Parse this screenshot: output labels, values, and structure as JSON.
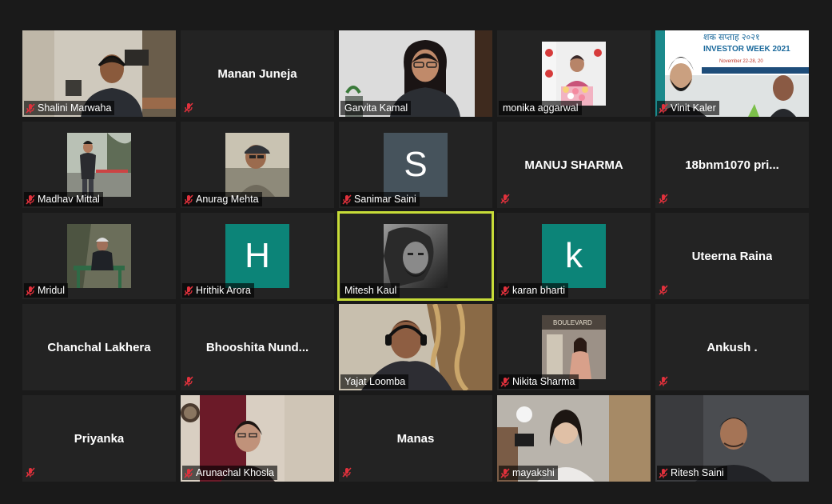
{
  "meeting": {
    "participants": [
      {
        "name": "Shalini Marwaha",
        "tile": "video",
        "scene": "man-office",
        "muted": true
      },
      {
        "name": "Manan Juneja",
        "tile": "name",
        "muted": true
      },
      {
        "name": "Garvita Kamal",
        "tile": "video",
        "scene": "woman-glasses",
        "muted": false
      },
      {
        "name": "monika aggarwal",
        "tile": "photo",
        "scene": "stage-speaker",
        "muted": false
      },
      {
        "name": "Vinit Kaler",
        "tile": "video",
        "scene": "banner-men",
        "muted": true,
        "banner_lines": [
          "शक सप्ताह २०२१",
          "INVESTOR WEEK 2021",
          "November 22-28, 20"
        ]
      },
      {
        "name": "Madhav Mittal",
        "tile": "photo",
        "scene": "man-standing",
        "muted": true
      },
      {
        "name": "Anurag Mehta",
        "tile": "photo",
        "scene": "man-cap-lake",
        "muted": true
      },
      {
        "name": "Sanimar Saini",
        "tile": "letter",
        "letter": "S",
        "avatar_color": "#46535c",
        "muted": true
      },
      {
        "name": "MANUJ SHARMA",
        "tile": "name",
        "muted": true
      },
      {
        "name": "18bnm1070 pri...",
        "tile": "name",
        "muted": true
      },
      {
        "name": "Mridul",
        "tile": "photo",
        "scene": "man-bench",
        "muted": true
      },
      {
        "name": "Hrithik Arora",
        "tile": "letter",
        "letter": "H",
        "avatar_color": "#0c8478",
        "muted": true
      },
      {
        "name": "Mitesh Kaul",
        "tile": "photo",
        "scene": "bw-portrait",
        "muted": false,
        "active_speaker": true
      },
      {
        "name": "karan bharti",
        "tile": "letter",
        "letter": "k",
        "avatar_color": "#0c8478",
        "muted": true
      },
      {
        "name": "Uteerna Raina",
        "tile": "name",
        "muted": true
      },
      {
        "name": "Chanchal Lakhera",
        "tile": "name",
        "muted": false
      },
      {
        "name": "Bhooshita  Nund...",
        "tile": "name",
        "muted": true
      },
      {
        "name": "Yajat Loomba",
        "tile": "video",
        "scene": "man-headphones",
        "muted": false
      },
      {
        "name": "Nikita Sharma",
        "tile": "photo",
        "scene": "woman-boulevard",
        "muted": true
      },
      {
        "name": "Ankush .",
        "tile": "name",
        "muted": true
      },
      {
        "name": "Priyanka",
        "tile": "name",
        "muted": true
      },
      {
        "name": "Arunachal Khosla",
        "tile": "video",
        "scene": "woman-room",
        "muted": true
      },
      {
        "name": "Manas",
        "tile": "name",
        "muted": true
      },
      {
        "name": "mayakshi",
        "tile": "video",
        "scene": "girl-room",
        "muted": true
      },
      {
        "name": "Ritesh Saini",
        "tile": "video",
        "scene": "man-dark",
        "muted": true
      }
    ],
    "colors": {
      "background": "#1a1a1a",
      "tile": "#232323",
      "active_border": "#c7dc38",
      "muted_icon": "#e2313c"
    }
  }
}
